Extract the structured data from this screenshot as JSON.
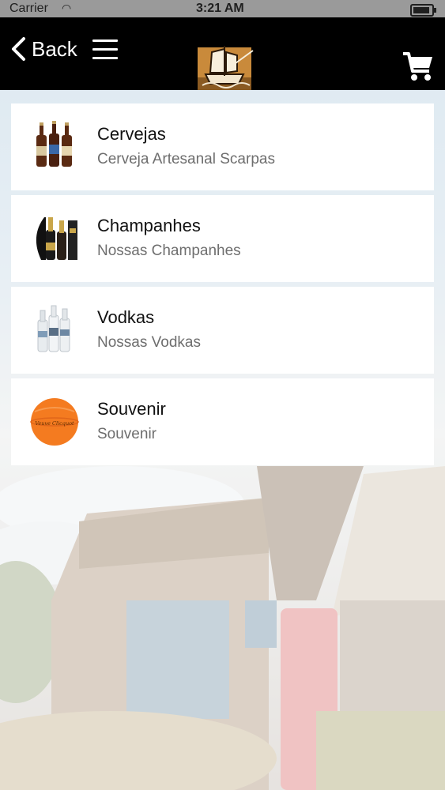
{
  "status_bar": {
    "carrier": "Carrier",
    "time": "3:21 AM",
    "wifi_icon": "wifi-icon",
    "battery_icon": "battery-icon"
  },
  "nav": {
    "back_label": "Back",
    "back_icon": "chevron-left-icon",
    "menu_icon": "hamburger-menu-icon",
    "logo": "ship-logo",
    "cart_icon": "shopping-cart-icon",
    "background_color": "#000000"
  },
  "categories": [
    {
      "title": "Cervejas",
      "subtitle": "Cerveja Artesanal Scarpas",
      "thumbnail": "beer-bottles"
    },
    {
      "title": "Champanhes",
      "subtitle": "Nossas Champanhes",
      "thumbnail": "champagne-bottles"
    },
    {
      "title": "Vodkas",
      "subtitle": "Nossas Vodkas",
      "thumbnail": "vodka-bottles"
    },
    {
      "title": "Souvenir",
      "subtitle": "Souvenir",
      "thumbnail": "orange-souvenir-ball",
      "thumbnail_text": "Veuve Clicquot"
    }
  ],
  "colors": {
    "row_background": "#ffffff",
    "title_text": "#111111",
    "subtitle_text": "#6e6e6e",
    "souvenir_orange": "#f47b20"
  }
}
